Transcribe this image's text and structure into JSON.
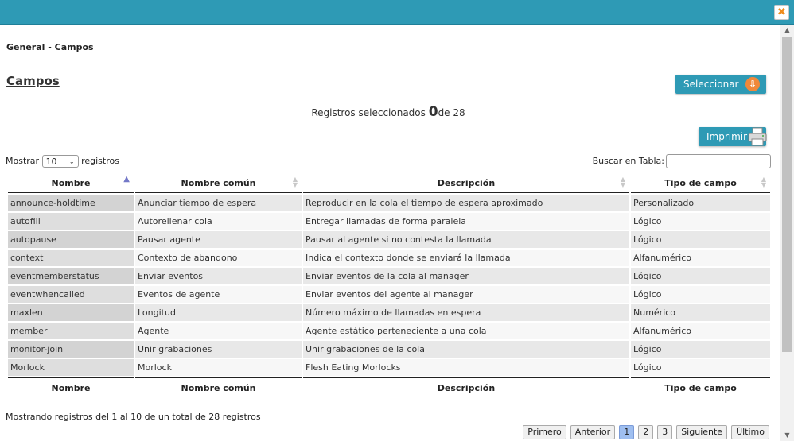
{
  "window": {
    "close_label": "✖"
  },
  "breadcrumb": "General - Campos",
  "page_title": "Campos",
  "select_button": {
    "label": "Seleccionar"
  },
  "print_button": {
    "label": "Imprimir"
  },
  "selection": {
    "prefix": "Registros seleccionados",
    "count": "0",
    "separator": "de",
    "total": "28"
  },
  "length_control": {
    "prefix": "Mostrar",
    "value": "10",
    "suffix": "registros"
  },
  "search": {
    "label": "Buscar en Tabla:",
    "value": ""
  },
  "columns": [
    "Nombre",
    "Nombre común",
    "Descripción",
    "Tipo de campo"
  ],
  "rows": [
    [
      "announce-holdtime",
      "Anunciar tiempo de espera",
      "Reproducir en la cola el tiempo de espera aproximado",
      "Personalizado"
    ],
    [
      "autofill",
      "Autorellenar cola",
      "Entregar llamadas de forma paralela",
      "Lógico"
    ],
    [
      "autopause",
      "Pausar agente",
      "Pausar al agente si no contesta la llamada",
      "Lógico"
    ],
    [
      "context",
      "Contexto de abandono",
      "Indica el contexto donde se enviará la llamada",
      "Alfanumérico"
    ],
    [
      "eventmemberstatus",
      "Enviar eventos",
      "Enviar eventos de la cola al manager",
      "Lógico"
    ],
    [
      "eventwhencalled",
      "Eventos de agente",
      "Enviar eventos del agente al manager",
      "Lógico"
    ],
    [
      "maxlen",
      "Longitud",
      "Número máximo de llamadas en espera",
      "Numérico"
    ],
    [
      "member",
      "Agente",
      "Agente estático perteneciente a una cola",
      "Alfanumérico"
    ],
    [
      "monitor-join",
      "Unir grabaciones",
      "Unir grabaciones de la cola",
      "Lógico"
    ],
    [
      "Morlock",
      "Morlock",
      "Flesh Eating Morlocks",
      "Lógico"
    ]
  ],
  "info": "Mostrando registros del 1 al 10 de un total de 28 registros",
  "pagination": {
    "first": "Primero",
    "prev": "Anterior",
    "pages": [
      "1",
      "2",
      "3"
    ],
    "next": "Siguiente",
    "last": "Último"
  }
}
